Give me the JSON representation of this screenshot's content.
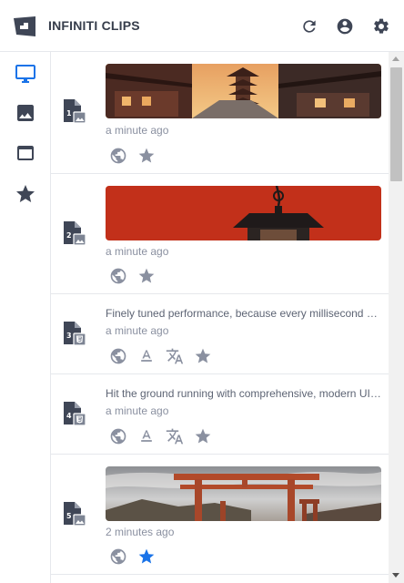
{
  "app": {
    "title": "INFINITI CLIPS"
  },
  "header": {
    "icons": [
      "refresh-icon",
      "account-icon",
      "settings-icon"
    ]
  },
  "sidebar": {
    "items": [
      {
        "icon": "desktop-icon",
        "active": true
      },
      {
        "icon": "image-icon",
        "active": false
      },
      {
        "icon": "window-icon",
        "active": false
      },
      {
        "icon": "star-icon",
        "active": false
      }
    ]
  },
  "colors": {
    "accent": "#1a73e8",
    "icon": "#3f4656",
    "muted": "#8a90a0"
  },
  "clips": [
    {
      "number": "1",
      "type": "image",
      "thumbnail": "pagoda-street-photo",
      "timestamp": "a minute ago",
      "starred": false
    },
    {
      "number": "2",
      "type": "image",
      "thumbnail": "red-lantern-photo",
      "timestamp": "a minute ago",
      "starred": false
    },
    {
      "number": "3",
      "type": "html",
      "text": "Finely tuned performance, because every millisecond counts.",
      "timestamp": "a minute ago",
      "starred": false
    },
    {
      "number": "4",
      "type": "html",
      "text": "Hit the ground running with comprehensive, modern UI components.",
      "timestamp": "a minute ago",
      "starred": false
    },
    {
      "number": "5",
      "type": "image",
      "thumbnail": "torii-gate-photo",
      "timestamp": "2 minutes ago",
      "starred": true
    }
  ]
}
